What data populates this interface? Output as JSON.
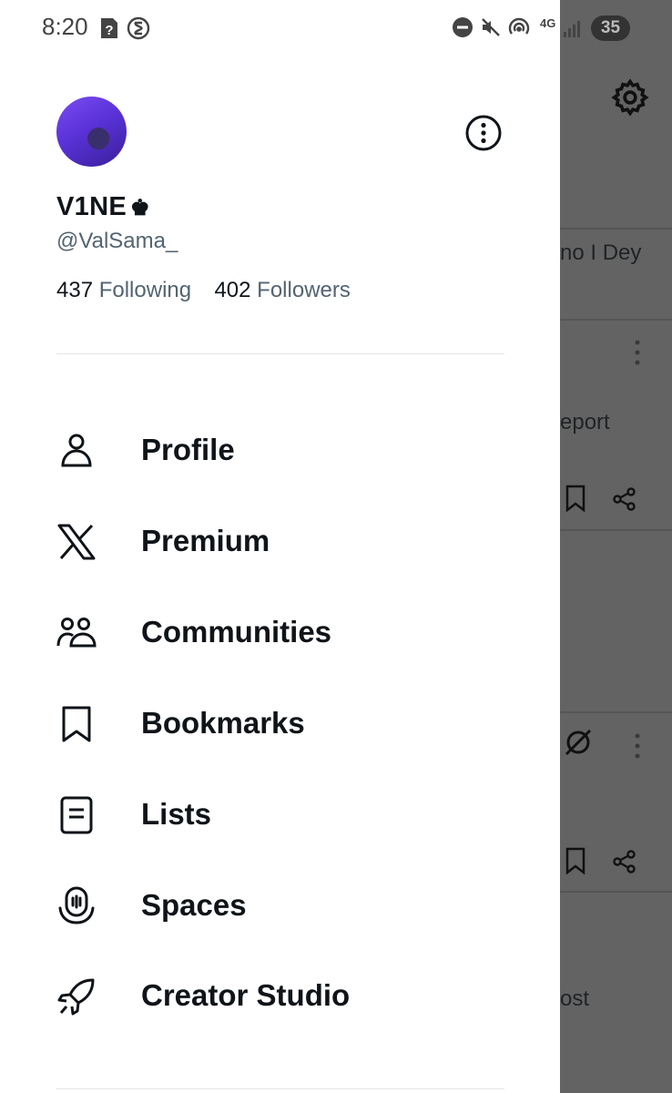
{
  "status_bar": {
    "time": "8:20",
    "network": "4G",
    "battery": "35"
  },
  "profile": {
    "name": "V1NE",
    "name_badge": "♚",
    "handle": "@ValSama_",
    "following_count": "437",
    "following_label": "Following",
    "followers_count": "402",
    "followers_label": "Followers"
  },
  "menu": [
    {
      "label": "Profile",
      "icon": "person-icon"
    },
    {
      "label": "Premium",
      "icon": "x-logo-icon"
    },
    {
      "label": "Communities",
      "icon": "communities-icon"
    },
    {
      "label": "Bookmarks",
      "icon": "bookmark-icon"
    },
    {
      "label": "Lists",
      "icon": "list-icon"
    },
    {
      "label": "Spaces",
      "icon": "spaces-icon"
    },
    {
      "label": "Creator Studio",
      "icon": "rocket-icon"
    }
  ],
  "background_feed": {
    "snippet_1": "no I Dey",
    "snippet_2": "eport",
    "snippet_3": "ost"
  },
  "colors": {
    "drawer_bg": "#ffffff",
    "text": "#0f1419",
    "secondary_text": "#536471",
    "overlay": "#636363"
  }
}
